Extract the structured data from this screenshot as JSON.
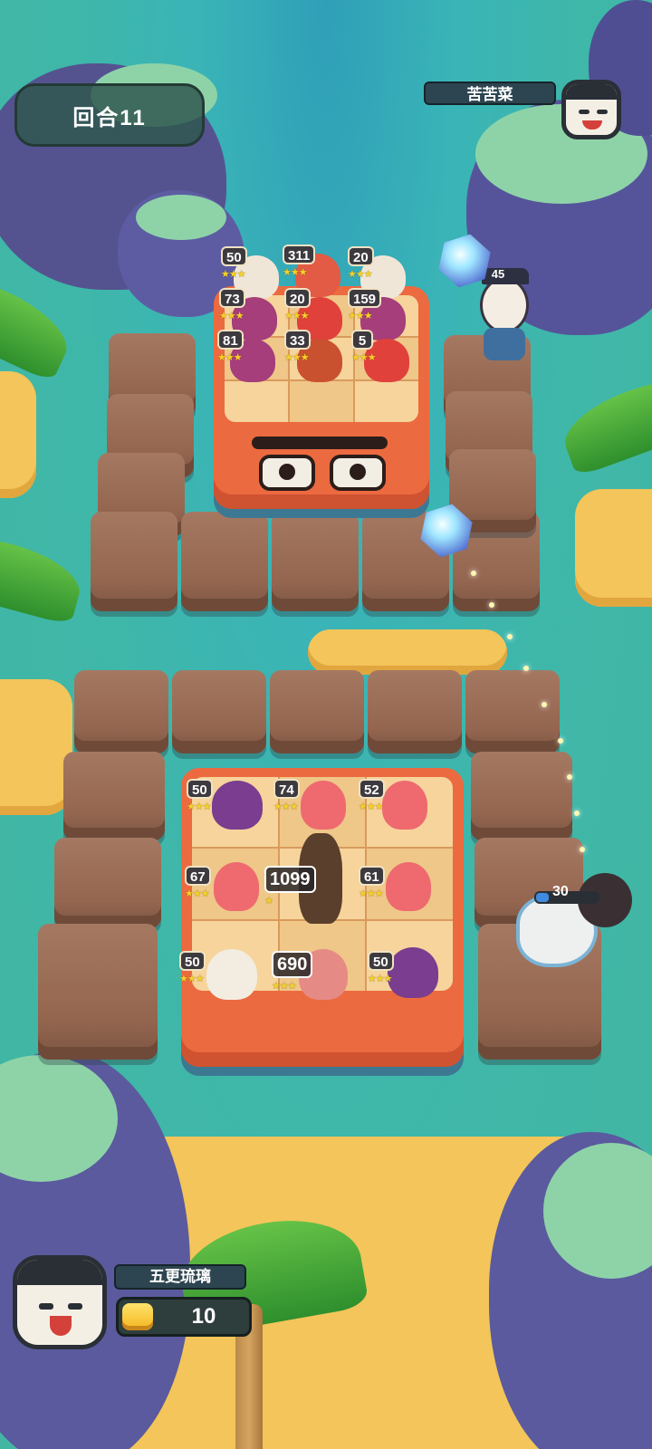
{
  "hud": {
    "round_label": "回合11",
    "opponent_name": "苦苦菜",
    "player_name": "五更琉璃",
    "gold": "10"
  },
  "opponent_board": {
    "units": [
      {
        "level": "50",
        "stars": "★★★",
        "color": "#f0e6d8"
      },
      {
        "level": "311",
        "stars": "★★★",
        "color": "#e35a45"
      },
      {
        "level": "20",
        "stars": "★★★",
        "color": "#f0e6d8"
      },
      {
        "level": "73",
        "stars": "★★★",
        "color": "#a53e7a"
      },
      {
        "level": "20",
        "stars": "★★★",
        "color": "#e0413b"
      },
      {
        "level": "159",
        "stars": "★★★",
        "color": "#a53e7a"
      },
      {
        "level": "81",
        "stars": "★★★",
        "color": "#a53e7a"
      },
      {
        "level": "33",
        "stars": "★★★",
        "color": "#c9512f"
      },
      {
        "level": "5",
        "stars": "★★★",
        "color": "#e0413b"
      }
    ],
    "ally_level": "45"
  },
  "player_board": {
    "units": [
      {
        "level": "50",
        "stars": "★★★",
        "color": "#7a3d8f"
      },
      {
        "level": "74",
        "stars": "★★★",
        "color": "#ee6a6f"
      },
      {
        "level": "52",
        "stars": "★★★",
        "color": "#ee6a6f"
      },
      {
        "level": "67",
        "stars": "★★★",
        "color": "#ee6a6f"
      },
      {
        "level": "1099",
        "stars": "★",
        "color": "#5a3f2c"
      },
      {
        "level": "61",
        "stars": "★★★",
        "color": "#ee6a6f"
      },
      {
        "level": "50",
        "stars": "★★★",
        "color": "#f3ece0"
      },
      {
        "level": "690",
        "stars": "★★★",
        "color": "#e68a86"
      },
      {
        "level": "50",
        "stars": "★★★",
        "color": "#7a3d8f"
      }
    ],
    "enemy_hp": "30"
  },
  "colors": {
    "water": "#3fb7a9",
    "board": "#ec6a3f",
    "stone": "#9a6b55",
    "rock": "#5b5a9e",
    "gold": "#f3b51d"
  }
}
